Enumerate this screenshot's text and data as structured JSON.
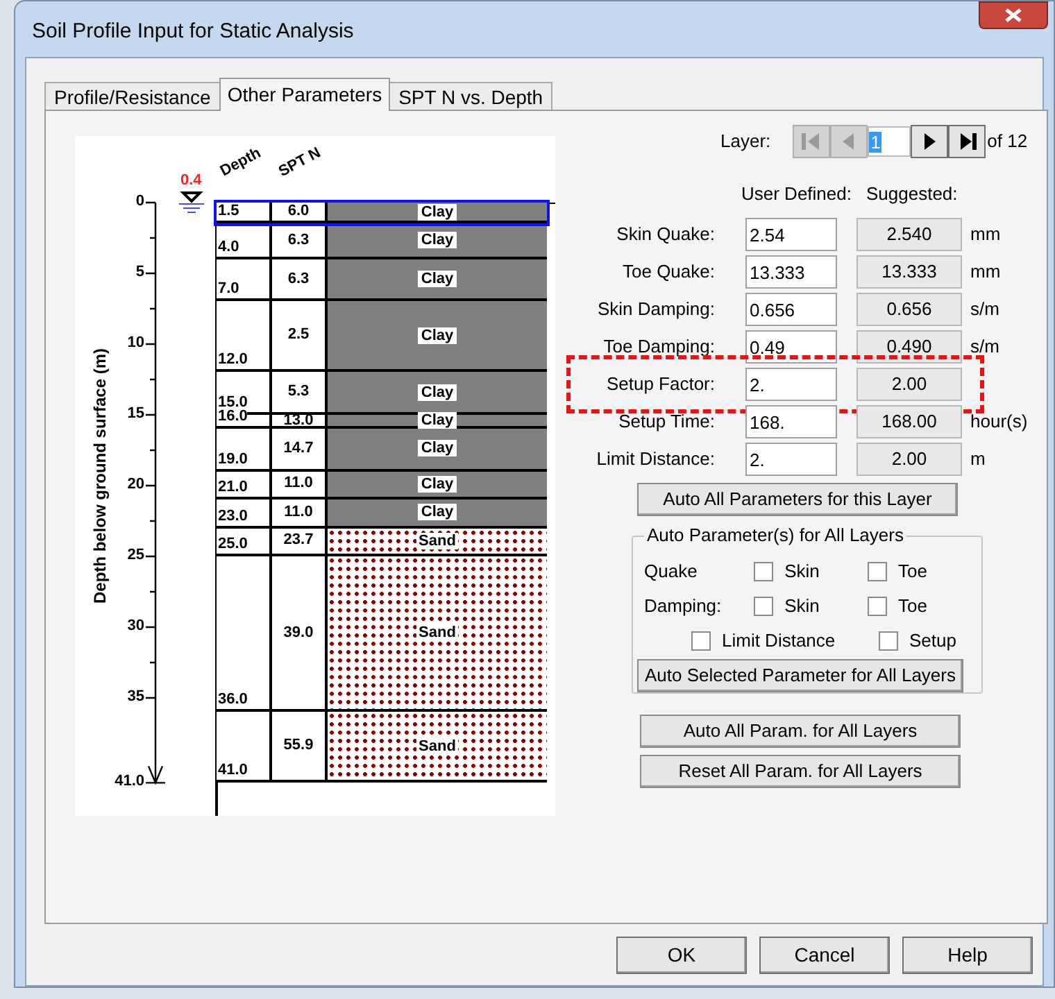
{
  "window": {
    "title": "Soil Profile Input for Static Analysis"
  },
  "tabs": [
    {
      "label": "Profile/Resistance",
      "selected": false
    },
    {
      "label": "Other Parameters",
      "selected": true
    },
    {
      "label": "SPT N vs. Depth",
      "selected": false
    }
  ],
  "profile": {
    "axis_title": "Depth below ground surface (m)",
    "axis_ticks": [
      "0",
      "5",
      "10",
      "15",
      "20",
      "25",
      "30",
      "35",
      "41.0"
    ],
    "water_table": "0.4",
    "column_headers": [
      "Depth",
      "SPT N"
    ],
    "layers": [
      {
        "depth": "1.5",
        "spt_n": "6.0",
        "soil": "Clay",
        "kind": "clay",
        "selected": true
      },
      {
        "depth": "4.0",
        "spt_n": "6.3",
        "soil": "Clay",
        "kind": "clay",
        "selected": false
      },
      {
        "depth": "7.0",
        "spt_n": "6.3",
        "soil": "Clay",
        "kind": "clay",
        "selected": false
      },
      {
        "depth": "12.0",
        "spt_n": "2.5",
        "soil": "Clay",
        "kind": "clay",
        "selected": false
      },
      {
        "depth": "15.0",
        "spt_n": "5.3",
        "soil": "Clay",
        "kind": "clay",
        "selected": false
      },
      {
        "depth": "16.0",
        "spt_n": "13.0",
        "soil": "Clay",
        "kind": "clay",
        "selected": false
      },
      {
        "depth": "19.0",
        "spt_n": "14.7",
        "soil": "Clay",
        "kind": "clay",
        "selected": false
      },
      {
        "depth": "21.0",
        "spt_n": "11.0",
        "soil": "Clay",
        "kind": "clay",
        "selected": false
      },
      {
        "depth": "23.0",
        "spt_n": "11.0",
        "soil": "Clay",
        "kind": "clay",
        "selected": false
      },
      {
        "depth": "25.0",
        "spt_n": "23.7",
        "soil": "Sand",
        "kind": "sand",
        "selected": false
      },
      {
        "depth": "36.0",
        "spt_n": "39.0",
        "soil": "Sand",
        "kind": "sand",
        "selected": false
      },
      {
        "depth": "41.0",
        "spt_n": "55.9",
        "soil": "Sand",
        "kind": "sand",
        "selected": false
      }
    ]
  },
  "layer_nav": {
    "label": "Layer:",
    "value": "1",
    "total": "of 12",
    "nav_buttons": [
      {
        "kind": "first",
        "disabled": true
      },
      {
        "kind": "previous",
        "disabled": true
      },
      {
        "kind": "next",
        "disabled": false
      },
      {
        "kind": "last",
        "disabled": false
      }
    ]
  },
  "parameters": {
    "headers": [
      "User Defined:",
      "Suggested:"
    ],
    "rows": [
      {
        "label": "Skin Quake:",
        "user": "2.54",
        "suggested": "2.540",
        "unit": "mm",
        "highlighted": false
      },
      {
        "label": "Toe Quake:",
        "user": "13.333",
        "suggested": "13.333",
        "unit": "mm",
        "highlighted": false
      },
      {
        "label": "Skin Damping:",
        "user": "0.656",
        "suggested": "0.656",
        "unit": "s/m",
        "highlighted": false
      },
      {
        "label": "Toe Damping:",
        "user": "0.49",
        "suggested": "0.490",
        "unit": "s/m",
        "highlighted": false
      },
      {
        "label": "Setup Factor:",
        "user": "2.",
        "suggested": "2.00",
        "highlighted": true
      },
      {
        "label": "Setup Time:",
        "user": "168.",
        "suggested": "168.00",
        "unit": "hour(s)",
        "highlighted": false
      },
      {
        "label": "Limit Distance:",
        "user": "2.",
        "suggested": "2.00",
        "unit": "m",
        "highlighted": false
      }
    ]
  },
  "auto_layer_button": "Auto All Parameters for this Layer",
  "auto_group": {
    "title": "Auto Parameter(s) for All Layers",
    "rows": [
      {
        "label": "Quake",
        "options": [
          {
            "label": "Skin",
            "checked": false
          },
          {
            "label": "Toe",
            "checked": false
          }
        ]
      },
      {
        "label": "Damping:",
        "options": [
          {
            "label": "Skin",
            "checked": false
          },
          {
            "label": "Toe",
            "checked": false
          }
        ]
      },
      {
        "options": [
          {
            "label": "Limit Distance",
            "checked": false
          },
          {
            "label": "Setup",
            "checked": false
          }
        ]
      }
    ],
    "button": "Auto Selected Parameter for All Layers"
  },
  "all_layers_buttons": [
    "Auto All Param. for All Layers",
    "Reset All Param. for All Layers"
  ],
  "dialog_buttons": [
    "OK",
    "Cancel",
    "Help"
  ]
}
